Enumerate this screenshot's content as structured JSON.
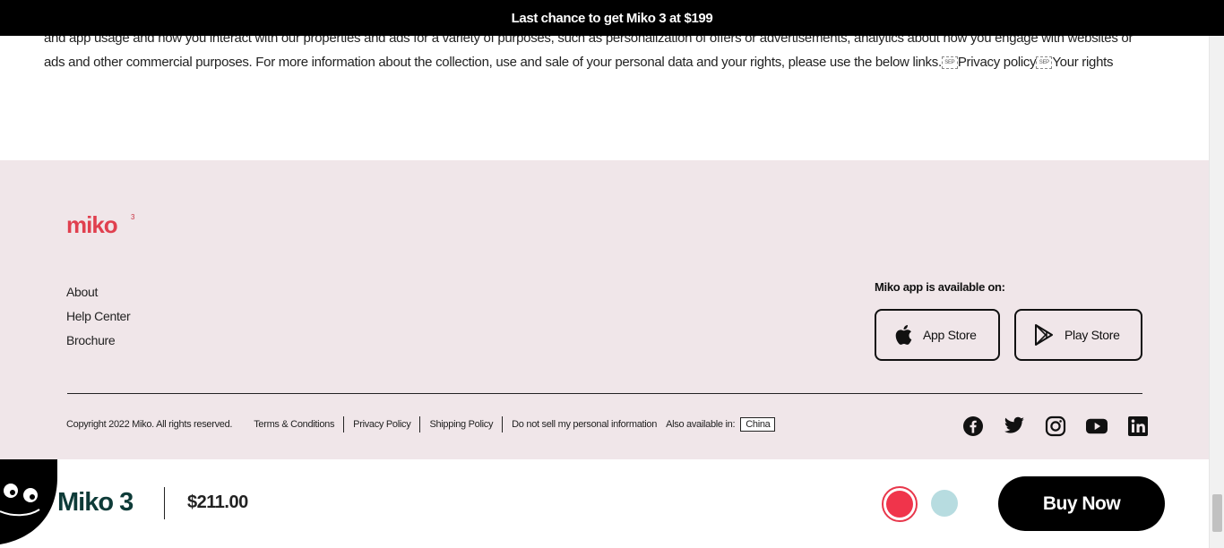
{
  "promo": {
    "text": "Last chance to get Miko 3 at",
    "price": "$199"
  },
  "privacy": {
    "line1": "and app usage and how you interact with our properties and ads for a variety of purposes, such as personalization of offers or advertisements, analytics about how you engage with",
    "line2": "websites or ads and other commercial purposes. For more information about the collection, use and sale of your personal data and your rights, please use the below links.",
    "sep_glyph": "SEP",
    "privacy_link": "Privacy policy",
    "rights_link": "Your rights"
  },
  "footer": {
    "logo": {
      "text": "miko",
      "sup": "3",
      "icon": "miko-logo"
    },
    "links": [
      "About",
      "Help Center",
      "Brochure"
    ],
    "app_title": "Miko app is available on:",
    "app_store": {
      "label": "App Store",
      "icon": "apple-icon"
    },
    "play_store": {
      "label": "Play Store",
      "icon": "play-store-icon"
    },
    "copyright": "Copyright 2022 Miko. All rights reserved.",
    "legal_links": [
      "Terms & Conditions",
      "Privacy Policy",
      "Shipping Policy",
      "Do not sell my personal information"
    ],
    "also_available": "Also available in:",
    "region": "China",
    "socials": [
      "facebook-icon",
      "twitter-icon",
      "instagram-icon",
      "youtube-icon",
      "linkedin-icon"
    ]
  },
  "buybar": {
    "product": "Miko 3",
    "price": "$211.00",
    "colors": [
      "#f0344b",
      "#b7dce0"
    ],
    "buy_label": "Buy Now"
  }
}
